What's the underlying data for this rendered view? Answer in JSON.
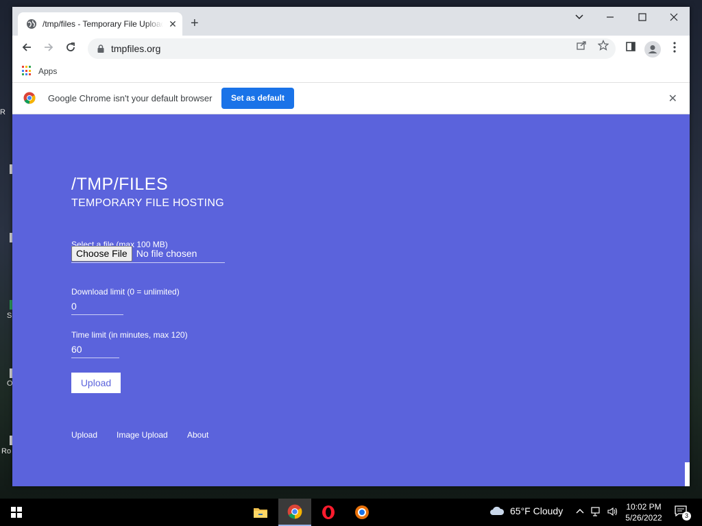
{
  "desktop": {
    "fragments": [
      "R",
      "S",
      "O",
      "Ro"
    ]
  },
  "browser": {
    "tab": {
      "title": "/tmp/files - Temporary File Upload",
      "close": "✕"
    },
    "new_tab": "+",
    "window_controls": {
      "menu": "⌵",
      "minimize": "—",
      "maximize": "☐",
      "close": "✕"
    },
    "url": "tmpfiles.org",
    "bookmarks": {
      "apps_label": "Apps"
    },
    "infobar": {
      "message": "Google Chrome isn't your default browser",
      "button": "Set as default",
      "close": "✕"
    }
  },
  "page": {
    "title": "/TMP/FILES",
    "subtitle": "TEMPORARY FILE HOSTING",
    "file_label": "Select a file (max 100 MB)",
    "choose_file": "Choose File",
    "no_file": "No file chosen",
    "download_label": "Download limit (0 = unlimited)",
    "download_value": "0",
    "time_label": "Time limit (in minutes, max 120)",
    "time_value": "60",
    "upload_button": "Upload",
    "footer_links": [
      "Upload",
      "Image Upload",
      "About"
    ]
  },
  "taskbar": {
    "weather": "65°F  Cloudy",
    "time": "10:02 PM",
    "date": "5/26/2022",
    "notification_count": "3"
  },
  "colors": {
    "page_bg": "#5b63dc",
    "accent_button": "#1a73e8",
    "chrome_frame": "#dee1e6"
  }
}
